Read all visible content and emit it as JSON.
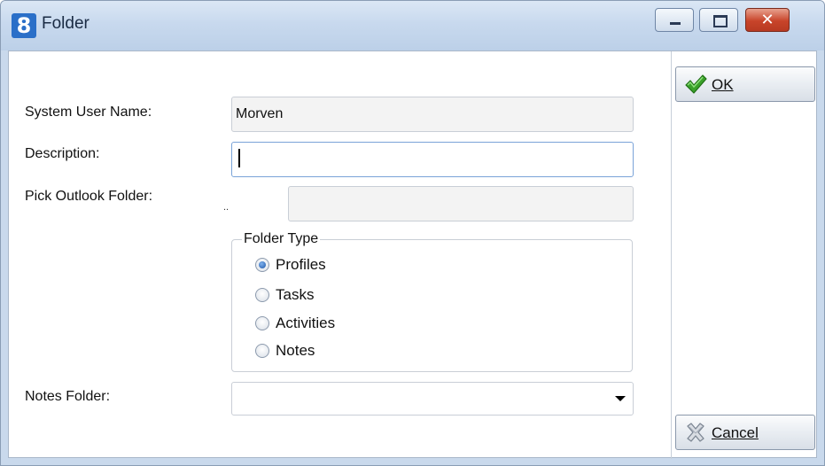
{
  "window": {
    "title": "Folder",
    "app_icon_glyph": "8",
    "controls": {
      "minimize": "minimize-icon",
      "maximize": "maximize-icon",
      "close": "✕"
    }
  },
  "form": {
    "system_user_name": {
      "label": "System User Name:",
      "value": "Morven"
    },
    "description": {
      "label": "Description:",
      "value": ""
    },
    "pick_outlook_folder": {
      "label": "Pick Outlook Folder:",
      "dots": "..",
      "value": ""
    },
    "folder_type": {
      "title": "Folder Type",
      "options": [
        "Profiles",
        "Tasks",
        "Activities",
        "Notes"
      ],
      "selected": "Profiles"
    },
    "notes_folder": {
      "label": "Notes Folder:",
      "value": ""
    }
  },
  "buttons": {
    "ok": {
      "label": "OK",
      "icon": "checkmark-icon",
      "color": "#3aa12a"
    },
    "cancel": {
      "label": "Cancel",
      "icon": "cancel-x-icon"
    }
  },
  "colors": {
    "titlebar": "#c8d9ee",
    "close_button": "#c8442a",
    "radio_selected": "#1c55a7"
  }
}
